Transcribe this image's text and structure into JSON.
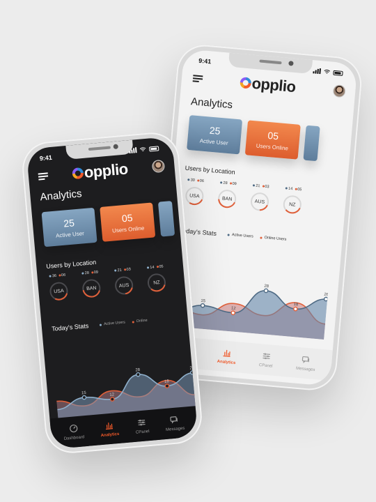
{
  "status_time": "9:41",
  "brand": "opplio",
  "page_title": "Analytics",
  "cards": [
    {
      "value": "25",
      "label": "Active User"
    },
    {
      "value": "05",
      "label": "Users Online"
    }
  ],
  "location_title": "Users by Location",
  "locations": [
    {
      "code": "USA",
      "active": "36",
      "online": "06",
      "fraction": 0.28
    },
    {
      "code": "BAN",
      "active": "28",
      "online": "09",
      "fraction": 0.42
    },
    {
      "code": "AUS",
      "active": "21",
      "online": "03",
      "fraction": 0.18
    },
    {
      "code": "NZ",
      "active": "14",
      "online": "05",
      "fraction": 0.32
    }
  ],
  "back_locations": [
    {
      "code": "USA",
      "active": "30",
      "online": "06",
      "fraction": 0.28
    },
    {
      "code": "BAN",
      "active": "28",
      "online": "09",
      "fraction": 0.42
    },
    {
      "code": "AUS",
      "active": "21",
      "online": "03",
      "fraction": 0.18
    },
    {
      "code": "NZ",
      "active": "14",
      "online": "05",
      "fraction": 0.32
    }
  ],
  "stats_title": "Today's Stats",
  "legend": {
    "active": "Active Users",
    "online": "Online Users",
    "online_truncated": "Online"
  },
  "colors": {
    "active": "#5f7d99",
    "online": "#e0603a",
    "accent": "#f25a2a"
  },
  "chart_data": {
    "type": "area",
    "series": [
      {
        "name": "Active Users",
        "values": [
          8,
          15,
          12,
          28,
          18,
          26
        ]
      },
      {
        "name": "Online Users",
        "values": [
          14,
          9,
          18,
          12,
          22,
          10
        ]
      }
    ],
    "labels": [
      "15",
      "12",
      "28",
      "18",
      "26"
    ]
  },
  "tabs": [
    {
      "label": "Dashboard",
      "icon": "dashboard-icon",
      "active": false
    },
    {
      "label": "Analytics",
      "icon": "bar-chart-icon",
      "active": true
    },
    {
      "label": "CPanel",
      "icon": "sliders-icon",
      "active": false
    },
    {
      "label": "Messages",
      "icon": "messages-icon",
      "active": false
    }
  ]
}
